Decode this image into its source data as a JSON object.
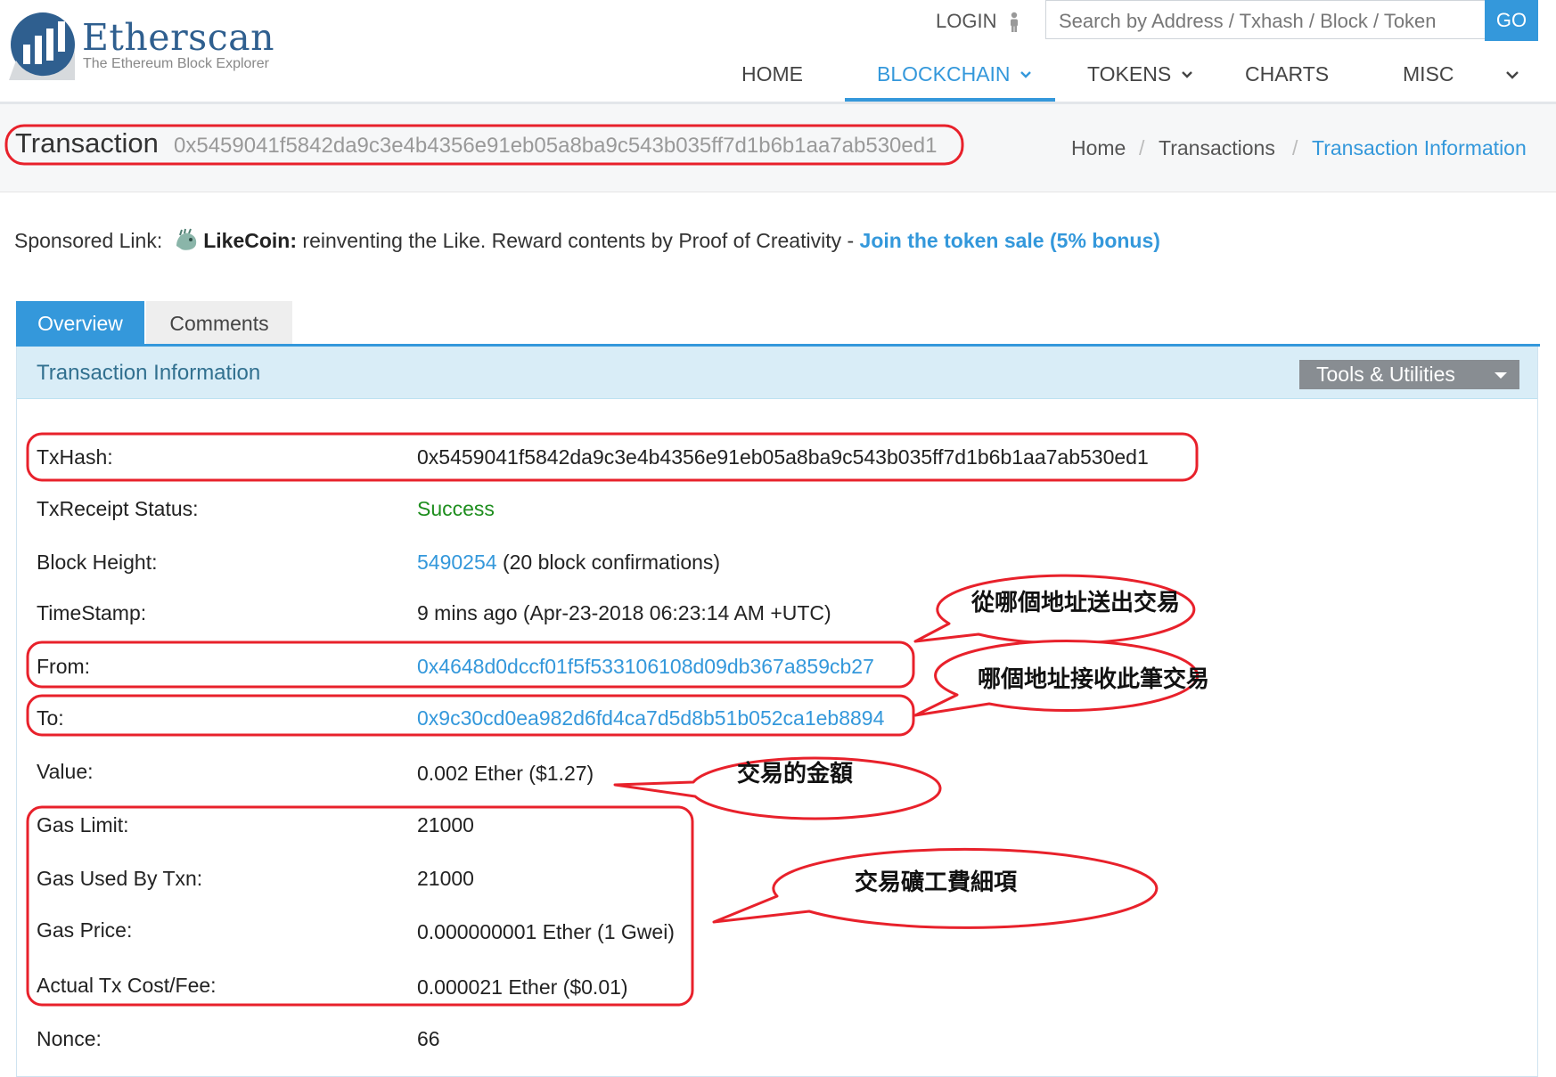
{
  "header": {
    "logo": {
      "name": "Etherscan",
      "tagline": "The Ethereum Block Explorer"
    },
    "login_label": "LOGIN",
    "search": {
      "placeholder": "Search by Address / Txhash / Block / Token",
      "go_label": "GO"
    },
    "nav": [
      {
        "label": "HOME"
      },
      {
        "label": "BLOCKCHAIN",
        "active": true,
        "dropdown": true
      },
      {
        "label": "TOKENS",
        "dropdown": true
      },
      {
        "label": "CHARTS"
      },
      {
        "label": "MISC"
      }
    ]
  },
  "title_bar": {
    "title": "Transaction",
    "hash": "0x5459041f5842da9c3e4b4356e91eb05a8ba9c543b035ff7d1b6b1aa7ab530ed1",
    "breadcrumb": [
      "Home",
      "Transactions",
      "Transaction Information"
    ],
    "separator": "/"
  },
  "sponsored": {
    "label": "Sponsored Link:",
    "brand": "LikeCoin:",
    "text": "reinventing the Like. Reward contents by Proof of Creativity -",
    "cta": "Join the token sale (5% bonus)"
  },
  "tabs": [
    {
      "label": "Overview",
      "active": true
    },
    {
      "label": "Comments"
    }
  ],
  "panel": {
    "title": "Transaction Information",
    "tools_label": "Tools & Utilities"
  },
  "tx": {
    "txhash": {
      "label": "TxHash:",
      "value": "0x5459041f5842da9c3e4b4356e91eb05a8ba9c543b035ff7d1b6b1aa7ab530ed1"
    },
    "status": {
      "label": "TxReceipt Status:",
      "value": "Success"
    },
    "block": {
      "label": "Block Height:",
      "value": "5490254",
      "confirmations": "(20 block confirmations)"
    },
    "timestamp": {
      "label": "TimeStamp:",
      "value": "9 mins ago (Apr-23-2018 06:23:14 AM +UTC)"
    },
    "from": {
      "label": "From:",
      "value": "0x4648d0dccf01f5f533106108d09db367a859cb27"
    },
    "to": {
      "label": "To:",
      "value": "0x9c30cd0ea982d6fd4ca7d5d8b51b052ca1eb8894"
    },
    "value": {
      "label": "Value:",
      "value": "0.002 Ether ($1.27)"
    },
    "gas_limit": {
      "label": "Gas Limit:",
      "value": "21000"
    },
    "gas_used": {
      "label": "Gas Used By Txn:",
      "value": "21000"
    },
    "gas_price": {
      "label": "Gas Price:",
      "value": "0.000000001 Ether (1 Gwei)"
    },
    "fee": {
      "label": "Actual Tx Cost/Fee:",
      "value": "0.000021 Ether ($0.01)"
    },
    "nonce": {
      "label": "Nonce:",
      "value": "66"
    }
  },
  "annotations": {
    "from_note": "從哪個地址送出交易",
    "to_note": "哪個地址接收此筆交易",
    "value_note": "交易的金額",
    "gas_note": "交易礦工費細項"
  },
  "colors": {
    "accent": "#3498db",
    "annotation_red": "#e8212b",
    "success_green": "#1e8e1e",
    "panel_head": "#d9edf7",
    "logo_blue": "#2f5f8f"
  }
}
